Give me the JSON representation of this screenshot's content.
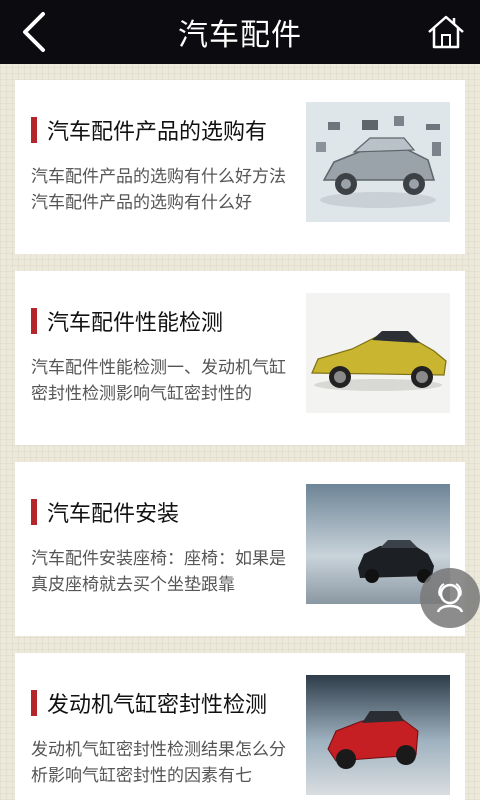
{
  "header": {
    "title": "汽车配件",
    "back_icon": "chevron-left-icon",
    "home_icon": "home-icon"
  },
  "articles": [
    {
      "title": "汽车配件产品的选购有",
      "desc": "汽车配件产品的选购有什么好方法汽车配件产品的选购有什么好",
      "thumb": "exploded-car-parts-image"
    },
    {
      "title": "汽车配件性能检测",
      "desc": "汽车配件性能检测一、发动机气缸密封性检测影响气缸密封性的",
      "thumb": "yellow-sports-car-image"
    },
    {
      "title": "汽车配件安装",
      "desc": "汽车配件安装座椅：座椅：如果是真皮座椅就去买个坐垫跟靠",
      "thumb": "black-sedan-image"
    },
    {
      "title": "发动机气缸密封性检测",
      "desc": "发动机气缸密封性检测结果怎么分析影响气缸密封性的因素有七",
      "thumb": "red-sports-car-image"
    }
  ],
  "floating_button": {
    "icon": "customer-service-icon"
  },
  "colors": {
    "topbar": "#0c0c10",
    "accent_bar": "#b3262b",
    "page_bg": "#ece8da",
    "card_bg": "#ffffff"
  }
}
